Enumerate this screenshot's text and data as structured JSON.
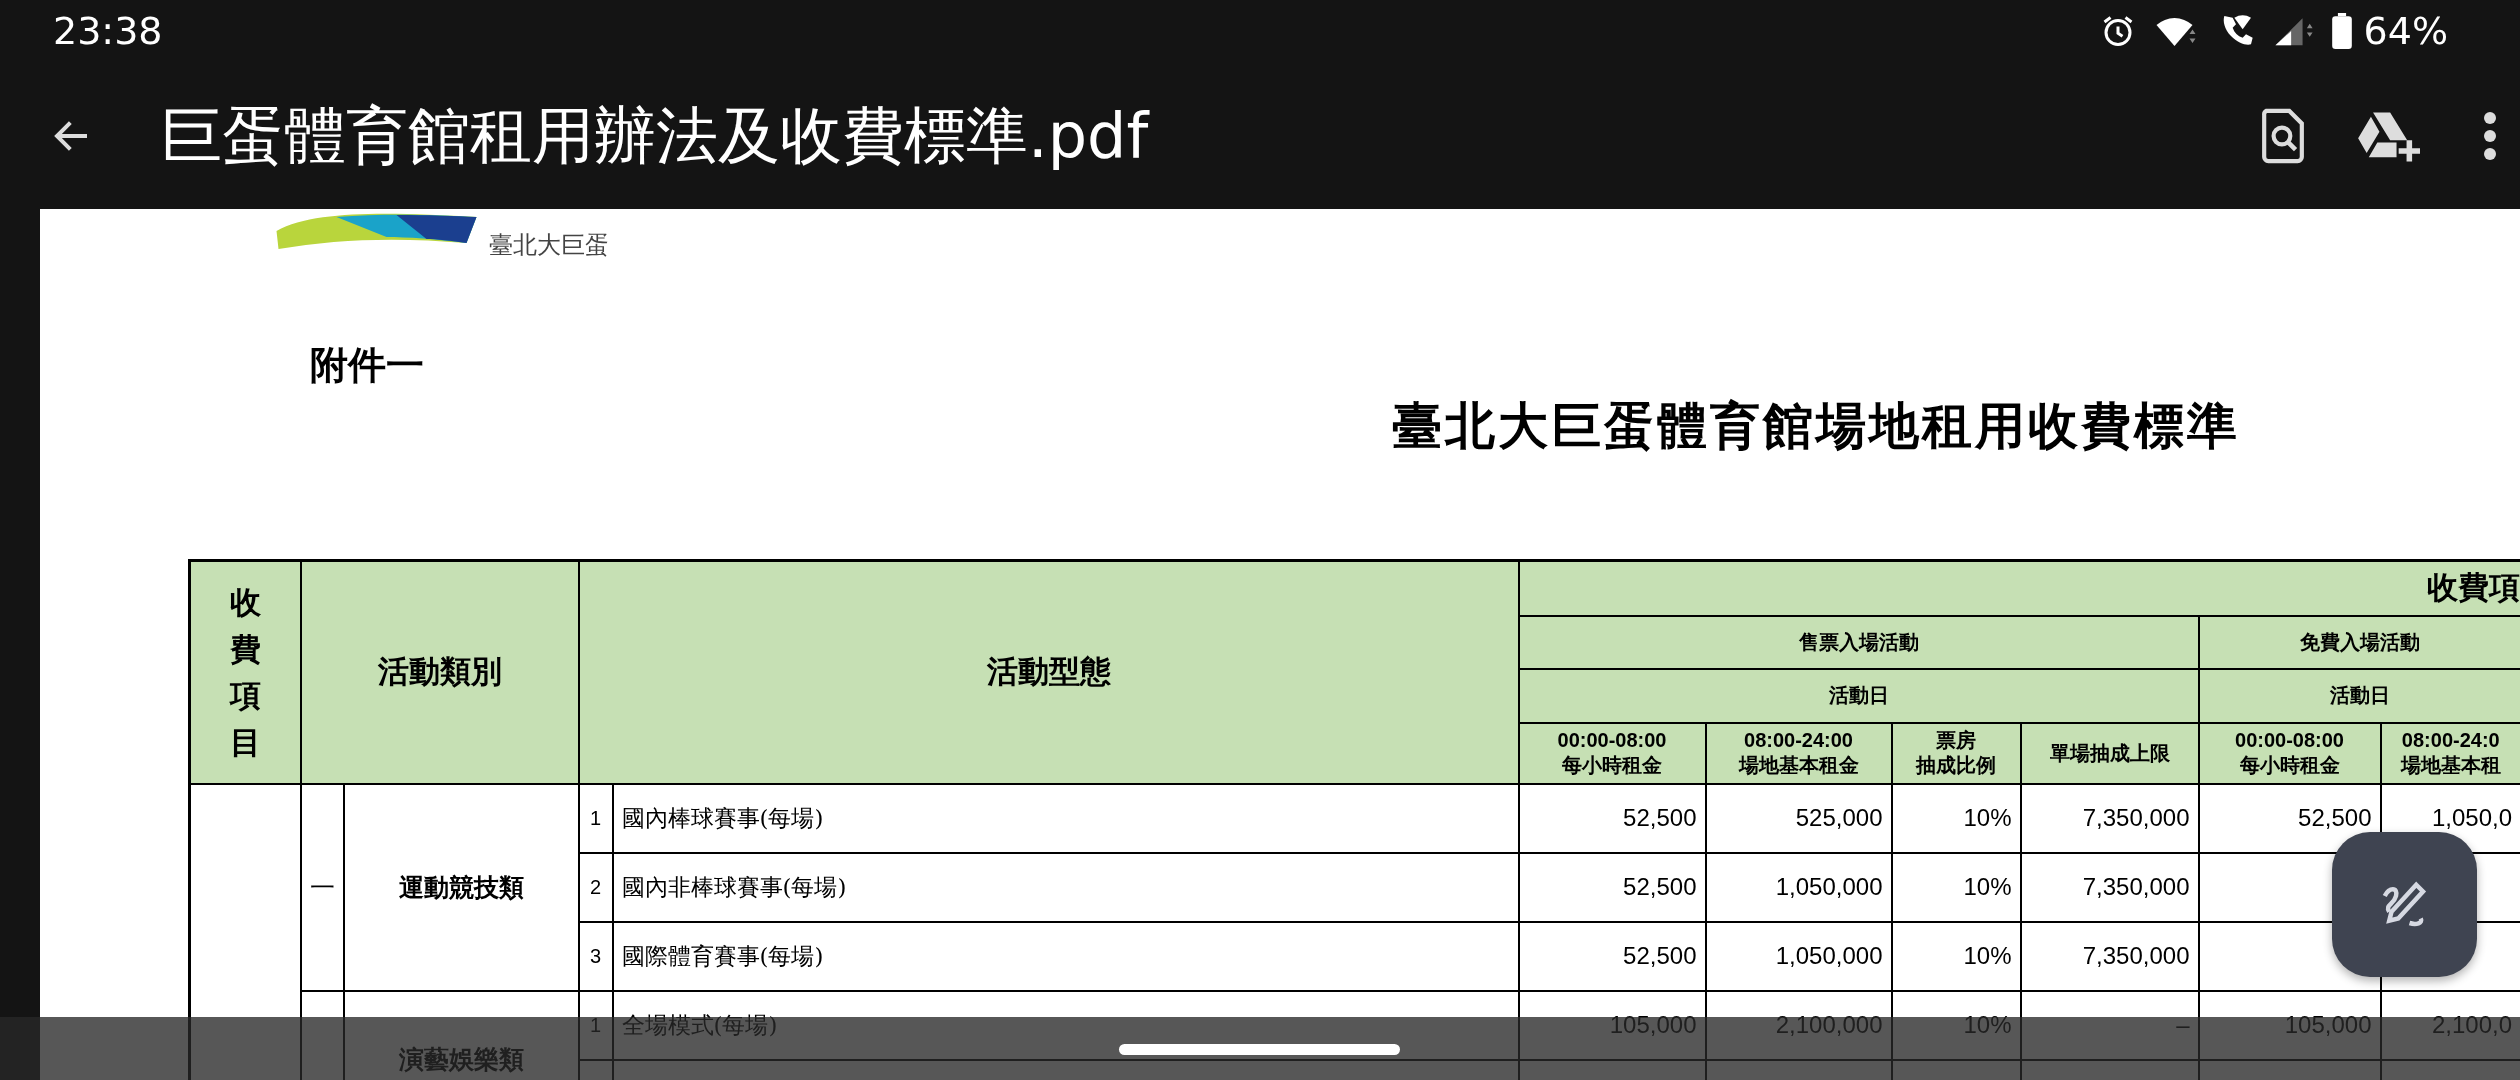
{
  "status_bar": {
    "time": "23:38",
    "battery": "64%"
  },
  "toolbar": {
    "title": "巨蛋體育館租用辦法及收費標準.pdf"
  },
  "document": {
    "logo_caption": "臺北大巨蛋",
    "attachment_label": "附件一",
    "title": "臺北大巨蛋體育館場地租用收費標準",
    "table": {
      "header": {
        "fee_item": "收費項目",
        "category": "活動類別",
        "type": "活動型態",
        "fee_group": "收費項",
        "ticketed": "售票入場活動",
        "free": "免費入場活動",
        "ticketed_day": "活動日",
        "free_day": "活動日",
        "columns": [
          {
            "lines": [
              "00:00-08:00",
              "每小時租金"
            ]
          },
          {
            "lines": [
              "08:00-24:00",
              "場地基本租金"
            ]
          },
          {
            "lines": [
              "票房",
              "抽成比例"
            ]
          },
          {
            "lines": [
              "單場抽成上限"
            ]
          },
          {
            "lines": [
              "00:00-08:00",
              "每小時租金"
            ]
          },
          {
            "lines": [
              "08:00-24:0",
              "場地基本租"
            ]
          }
        ]
      },
      "groups": [
        {
          "numeral": "一",
          "name": "運動競技類",
          "rows": [
            {
              "number": "1",
              "type": "國內棒球賽事(每場)",
              "fees": [
                "52,500",
                "525,000",
                "10%",
                "7,350,000",
                "52,500",
                "1,050,0"
              ]
            },
            {
              "number": "2",
              "type": "國內非棒球賽事(每場)",
              "fees": [
                "52,500",
                "1,050,000",
                "10%",
                "7,350,000"
              ]
            },
            {
              "number": "3",
              "type": "國際體育賽事(每場)",
              "fees": [
                "52,500",
                "1,050,000",
                "10%",
                "7,350,000"
              ]
            }
          ]
        },
        {
          "name": "演藝娛樂類",
          "rows": [
            {
              "number": "1",
              "type": "全場模式(每場)",
              "fees": [
                "105,000",
                "2,100,000",
                "10%",
                "–",
                "105,000",
                "2,100,0"
              ]
            }
          ]
        }
      ]
    }
  }
}
